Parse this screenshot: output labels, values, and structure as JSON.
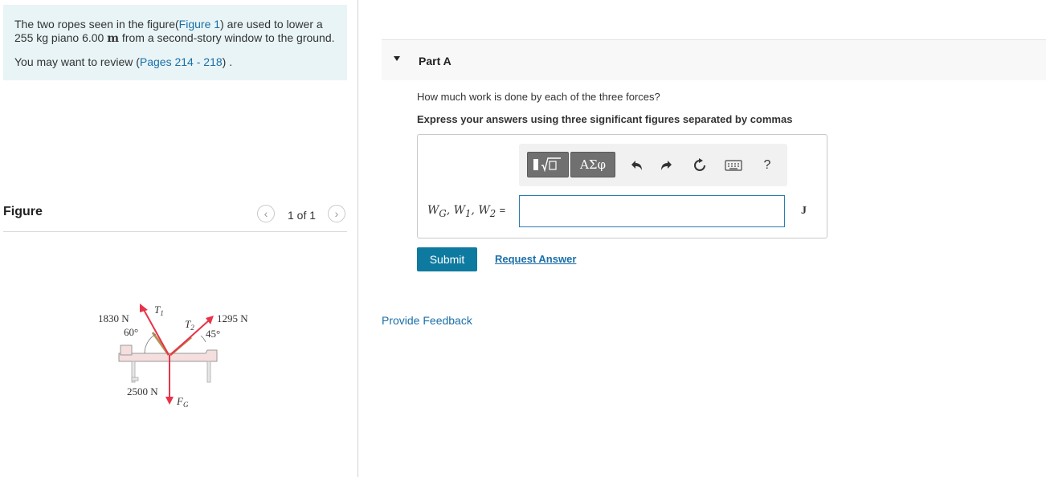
{
  "problem": {
    "text_part1": "The two ropes seen in the figure(",
    "figure_link": "Figure 1",
    "text_part2": ") are used to lower a 255 kg piano 6.00 ",
    "distance_unit": "m",
    "text_part3": " from a second-story window to the ground.",
    "review_prefix": "You may want to review (",
    "review_link": "Pages 214 - 218",
    "review_suffix": ") ."
  },
  "figure": {
    "label": "Figure",
    "pager": "1 of 1",
    "prev_icon": "chevron-left-icon",
    "next_icon": "chevron-right-icon",
    "force_t1": "1830 N",
    "angle_t1": "60°",
    "force_t2": "1295 N",
    "angle_t2": "45°",
    "force_g": "2500 N",
    "label_t1": "T",
    "label_t1_sub": "1",
    "label_t2": "T",
    "label_t2_sub": "2",
    "label_fg": "F",
    "label_fg_sub": "G"
  },
  "part": {
    "title": "Part A",
    "question": "How much work is done by each of the three forces?",
    "instruction": "Express your answers using three significant figures separated by commas"
  },
  "toolbar": {
    "templates_icon": "templates-icon",
    "symbols_label": "ΑΣφ",
    "undo_icon": "undo-icon",
    "redo_icon": "redo-icon",
    "reset_icon": "reset-icon",
    "keyboard_icon": "keyboard-icon",
    "help_label": "?"
  },
  "answer": {
    "label_w": "W",
    "label_sub_g": "G",
    "label_sub_1": "1",
    "label_sub_2": "2",
    "value": "",
    "unit": "J"
  },
  "actions": {
    "submit_label": "Submit",
    "request_answer_label": "Request Answer",
    "feedback_label": "Provide Feedback"
  },
  "colors": {
    "accent": "#0f7aa0",
    "link": "#1a6fa8",
    "problem_bg": "#e8f4f6",
    "arrow": "#e8334a"
  }
}
